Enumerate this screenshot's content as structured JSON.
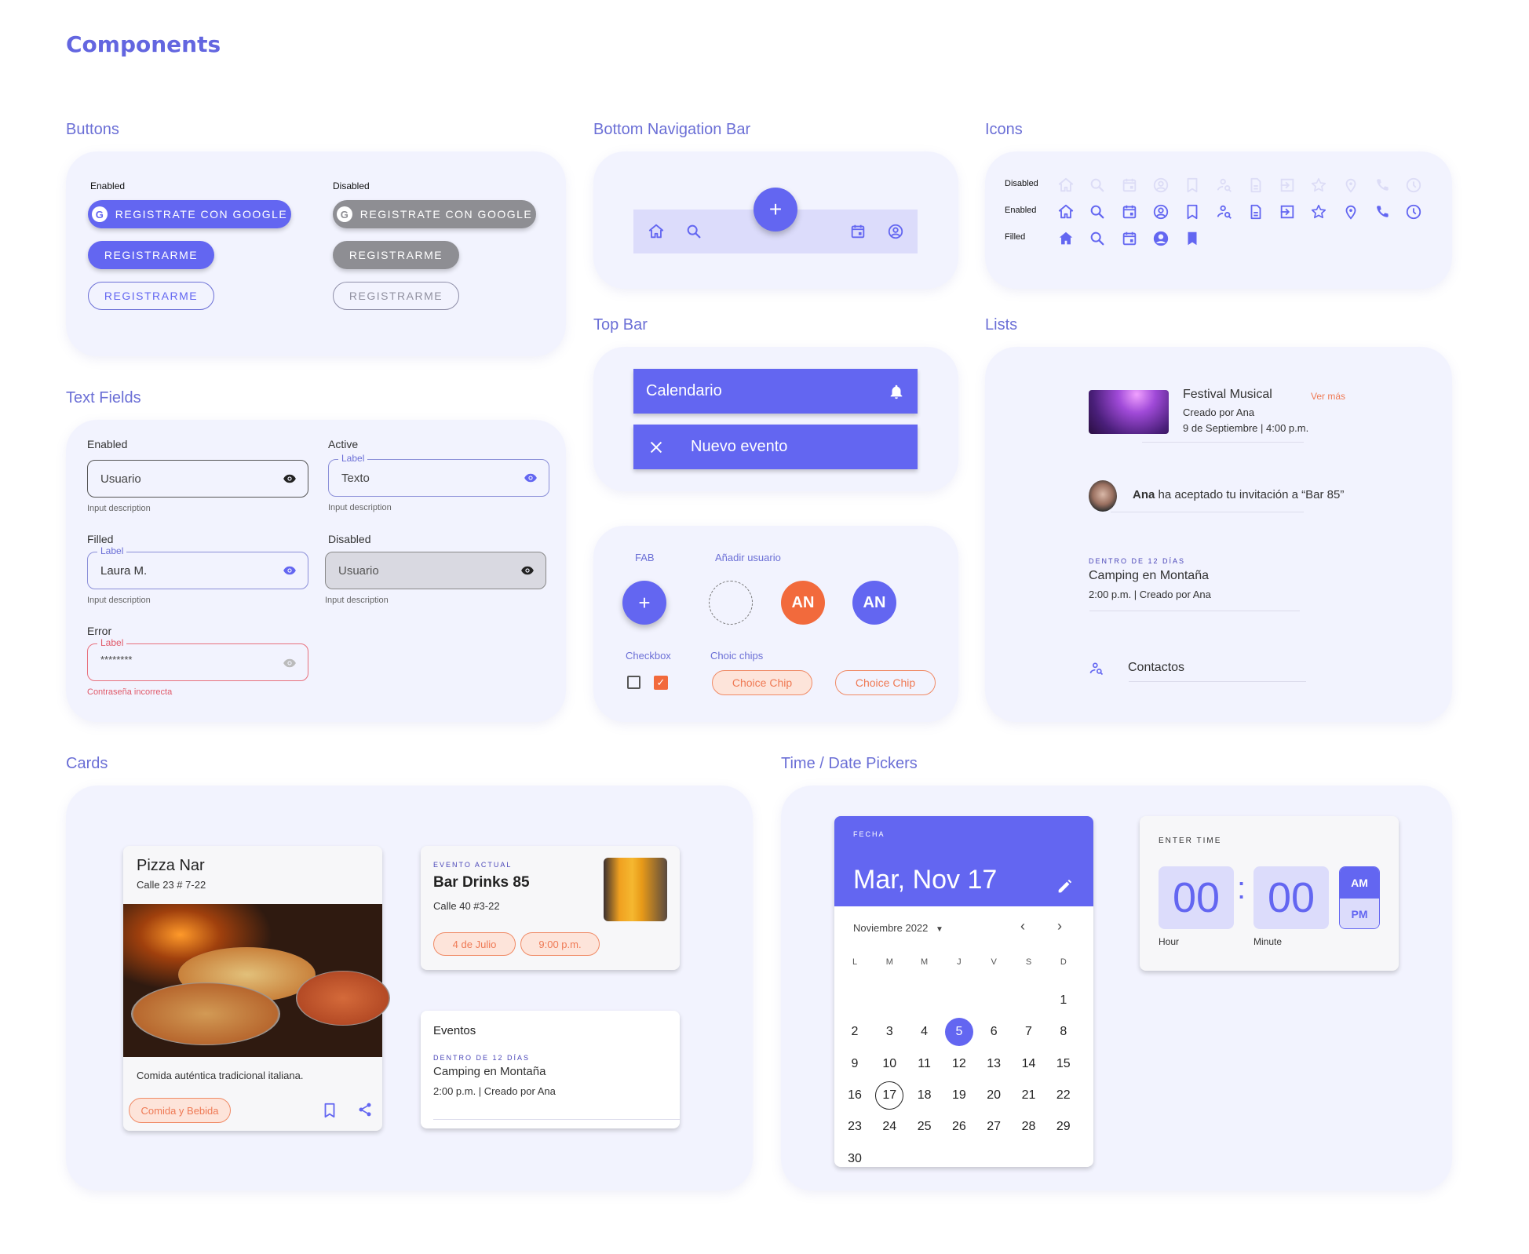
{
  "page_title": "Components",
  "colors": {
    "primary": "#6366f1",
    "accent": "#f26a3c",
    "panel": "#f2f3fe",
    "error": "#e05a6a",
    "disabled": "#8e8e93"
  },
  "buttons": {
    "heading": "Buttons",
    "enabled_label": "Enabled",
    "disabled_label": "Disabled",
    "google_label": "REGISTRATE CON GOOGLE",
    "register_label": "REGISTRARME",
    "google_glyph": "G"
  },
  "bottom_nav": {
    "heading": "Bottom Navigation Bar",
    "fab_glyph": "+",
    "items": [
      "home-icon",
      "search-icon",
      "calendar-icon",
      "account-icon"
    ]
  },
  "icons": {
    "heading": "Icons",
    "rows": [
      {
        "label": "Disabled",
        "icons": [
          "home",
          "search",
          "calendar",
          "account",
          "bookmark",
          "person-search",
          "document",
          "login",
          "star",
          "location",
          "phone",
          "clock"
        ]
      },
      {
        "label": "Enabled",
        "icons": [
          "home",
          "search",
          "calendar",
          "account",
          "bookmark",
          "person-search",
          "document",
          "login",
          "star",
          "location",
          "phone",
          "clock"
        ]
      },
      {
        "label": "Filled",
        "icons": [
          "home",
          "search",
          "calendar",
          "account",
          "bookmark"
        ]
      }
    ]
  },
  "top_bar": {
    "heading": "Top Bar",
    "bar1_title": "Calendario",
    "bar2_title": "Nuevo evento"
  },
  "text_fields": {
    "heading": "Text Fields",
    "enabled": {
      "title": "Enabled",
      "value": "Usuario",
      "desc": "Input description"
    },
    "active": {
      "title": "Active",
      "label": "Label",
      "value": "Texto",
      "desc": "Input description"
    },
    "filled": {
      "title": "Filled",
      "label": "Label",
      "value": "Laura M.",
      "desc": "Input description"
    },
    "disabled": {
      "title": "Disabled",
      "value": "Usuario",
      "desc": "Input description"
    },
    "error": {
      "title": "Error",
      "label": "Label",
      "value": "********",
      "desc": "Contraseña incorrecta"
    }
  },
  "controls": {
    "fab_label": "FAB",
    "fab_glyph": "+",
    "add_user_label": "Añadir usuario",
    "avatar_initials": "AN",
    "checkbox_label": "Checkbox",
    "chips_label": "Choic chips",
    "chip_text": "Choice Chip",
    "checkbox_states": [
      false,
      true
    ]
  },
  "lists": {
    "heading": "Lists",
    "item1": {
      "title": "Festival Musical",
      "line2": "Creado por Ana",
      "line3": "9 de Septiembre | 4:00 p.m.",
      "action": "Ver más"
    },
    "item2": {
      "bold": "Ana",
      "text": " ha aceptado tu invitación a “Bar 85”"
    },
    "item3": {
      "overline": "DENTRO DE 12 DÍAS",
      "title": "Camping en Montaña",
      "line2": "2:00 p.m. | Creado por Ana"
    },
    "item4": {
      "title": "Contactos"
    }
  },
  "cards": {
    "heading": "Cards",
    "pizza": {
      "title": "Pizza Nar",
      "subtitle": "Calle 23 # 7-22",
      "desc": "Comida auténtica tradicional italiana.",
      "chip": "Comida y Bebida"
    },
    "bar": {
      "overline": "EVENTO ACTUAL",
      "title": "Bar Drinks 85",
      "subtitle": "Calle 40 #3-22",
      "chips": [
        "4 de Julio",
        "9:00 p.m."
      ]
    },
    "events": {
      "title": "Eventos",
      "overline": "DENTRO DE 12 DÍAS",
      "item_title": "Camping en Montaña",
      "item_sub": "2:00 p.m. | Creado por Ana"
    }
  },
  "pickers": {
    "heading": "Time / Date Pickers",
    "date": {
      "overline": "FECHA",
      "selected_text": "Mar, Nov 17",
      "month": "Noviembre 2022",
      "weekdays": [
        "L",
        "M",
        "M",
        "J",
        "V",
        "S",
        "D"
      ],
      "first_weekday_index": 6,
      "days_in_month": 30,
      "highlighted_day": 5,
      "today_day": 17
    },
    "time": {
      "overline": "ENTER TIME",
      "hour": "00",
      "minute": "00",
      "separator": ":",
      "hour_label": "Hour",
      "minute_label": "Minute",
      "am": "AM",
      "pm": "PM",
      "selected_period": "AM"
    }
  }
}
